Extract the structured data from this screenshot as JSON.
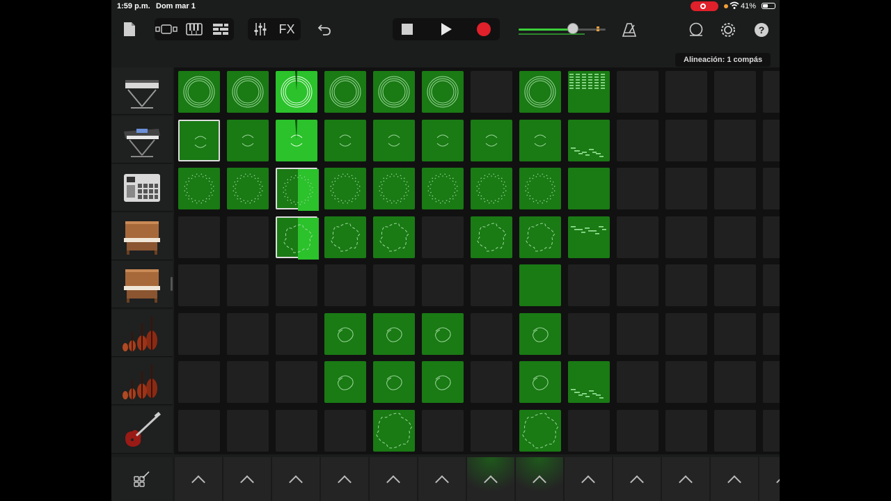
{
  "status_bar": {
    "time": "1:59 p.m.",
    "date": "Dom mar 1",
    "battery": "41%"
  },
  "toolbar": {
    "fx_label": "FX"
  },
  "alignment": {
    "label": "Alineación: 1 compás"
  },
  "volume": {
    "level": 0.62
  },
  "colors": {
    "clip": "#1a7a14",
    "clip_playing": "#2bc22b",
    "record": "#e0202a",
    "empty": "#202020"
  },
  "instruments": [
    {
      "name": "synth-keyboard-icon"
    },
    {
      "name": "synth-workstation-icon"
    },
    {
      "name": "drum-machine-icon"
    },
    {
      "name": "upright-piano-icon"
    },
    {
      "name": "upright-piano-icon"
    },
    {
      "name": "strings-ensemble-icon"
    },
    {
      "name": "strings-ensemble-icon"
    },
    {
      "name": "electric-guitar-icon"
    }
  ],
  "grid": {
    "columns": 13,
    "rows": [
      [
        "ring",
        "ring",
        "ring-playing",
        "ring",
        "ring",
        "ring",
        "empty",
        "ring",
        "notes",
        "empty",
        "empty",
        "empty",
        "empty"
      ],
      [
        "small-selected",
        "small",
        "small-playing",
        "small",
        "small",
        "small",
        "small",
        "small",
        "notes-low",
        "empty",
        "empty",
        "empty",
        "empty"
      ],
      [
        "dots",
        "dots",
        "dots-half",
        "dots",
        "dots",
        "dots",
        "dots",
        "dots",
        "plain",
        "empty",
        "empty",
        "empty",
        "empty"
      ],
      [
        "empty",
        "empty",
        "wave-half",
        "wave",
        "wave",
        "empty",
        "wave",
        "wave",
        "notes-mid",
        "empty",
        "empty",
        "empty",
        "empty"
      ],
      [
        "empty",
        "empty",
        "empty",
        "empty",
        "empty",
        "empty",
        "empty",
        "plain",
        "empty",
        "empty",
        "empty",
        "empty",
        "empty"
      ],
      [
        "empty",
        "empty",
        "empty",
        "swirl",
        "swirl",
        "swirl",
        "empty",
        "swirl",
        "empty",
        "empty",
        "empty",
        "empty",
        "empty"
      ],
      [
        "empty",
        "empty",
        "empty",
        "swirl",
        "swirl",
        "swirl",
        "empty",
        "swirl",
        "notes-low",
        "empty",
        "empty",
        "empty",
        "empty"
      ],
      [
        "empty",
        "empty",
        "empty",
        "empty",
        "wave-big",
        "empty",
        "empty",
        "wave-big",
        "empty",
        "empty",
        "empty",
        "empty",
        "empty"
      ]
    ]
  },
  "triggers": {
    "active_columns": [
      6,
      7
    ]
  }
}
